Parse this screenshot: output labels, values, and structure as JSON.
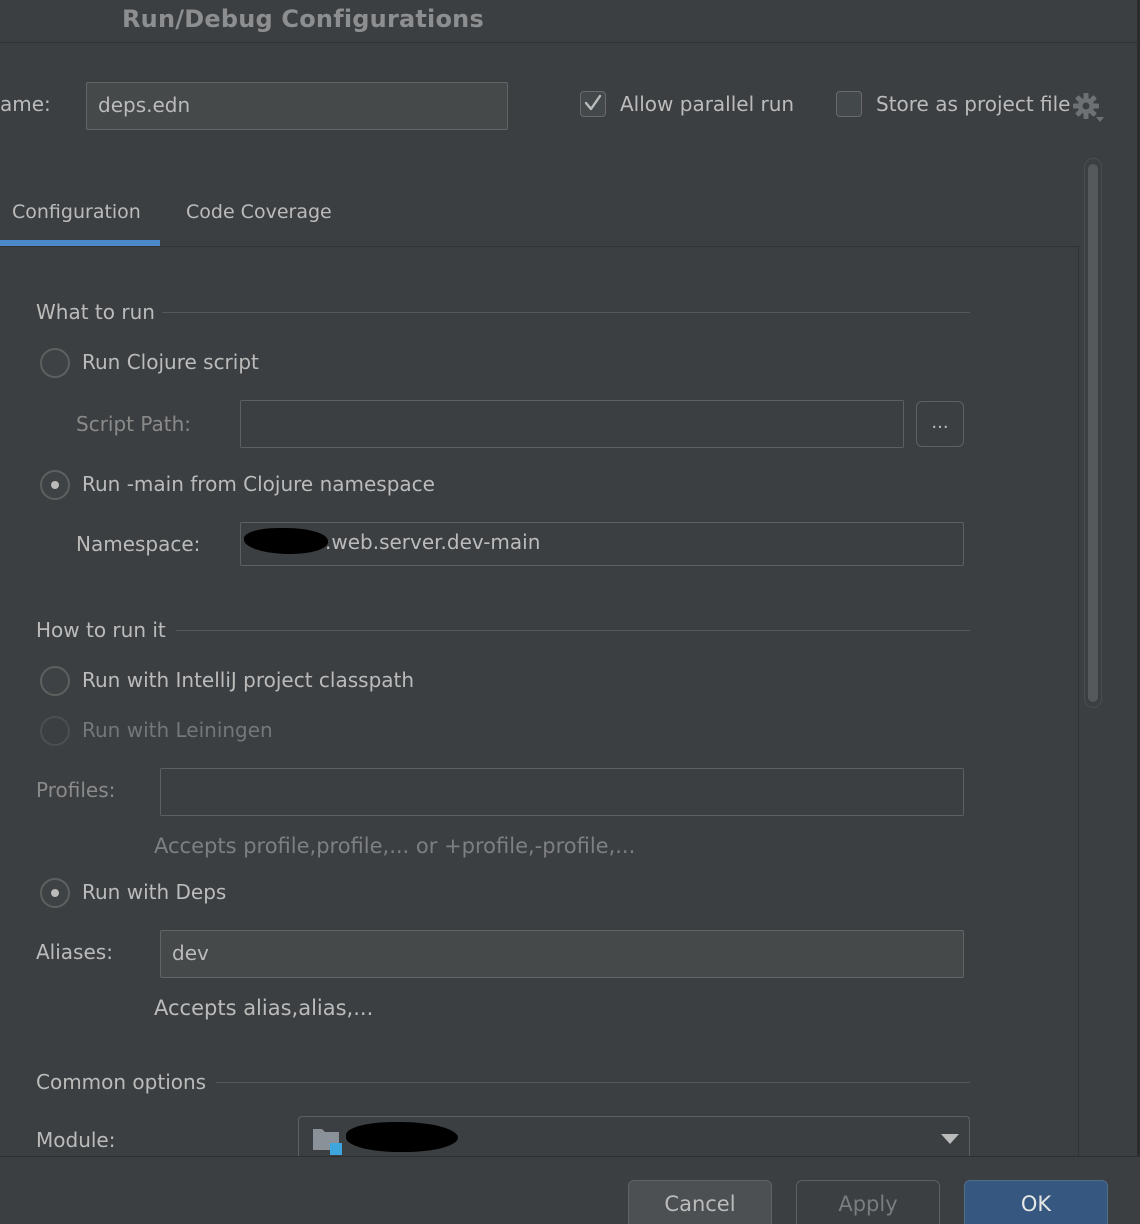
{
  "window": {
    "title": "Run/Debug Configurations"
  },
  "header": {
    "name_label": "ame:",
    "name_value": "deps.edn",
    "allow_parallel_run": {
      "label": "Allow parallel run",
      "checked": true
    },
    "store_as_project_file": {
      "label": "Store as project file",
      "checked": false
    }
  },
  "tabs": [
    {
      "label": "Configuration",
      "active": true
    },
    {
      "label": "Code Coverage",
      "active": false
    }
  ],
  "what_to_run": {
    "heading": "What to run",
    "run_clojure_script": {
      "label": "Run Clojure script",
      "checked": false
    },
    "script_path_label": "Script Path:",
    "script_path_value": "",
    "browse_label": "...",
    "run_main": {
      "label": "Run -main from Clojure namespace",
      "checked": true
    },
    "namespace_label": "Namespace:",
    "namespace_value": ".web.server.dev-main"
  },
  "how_to_run": {
    "heading": "How to run it",
    "intellij_classpath": {
      "label": "Run with IntelliJ project classpath",
      "checked": false
    },
    "leiningen": {
      "label": "Run with Leiningen",
      "checked": false,
      "disabled": true
    },
    "profiles_label": "Profiles:",
    "profiles_value": "",
    "profiles_hint": "Accepts profile,profile,... or +profile,-profile,...",
    "deps": {
      "label": "Run with Deps",
      "checked": true
    },
    "aliases_label": "Aliases:",
    "aliases_value": "dev",
    "aliases_hint": "Accepts alias,alias,..."
  },
  "common_options": {
    "heading": "Common options",
    "module_label": "Module:",
    "module_icon": "folder-module-icon"
  },
  "footer": {
    "cancel_label": "Cancel",
    "apply_label": "Apply",
    "ok_label": "OK"
  },
  "colors": {
    "background": "#3c3f41",
    "accent": "#4a88c7",
    "ok_button": "#365880",
    "module_icon_badge": "#3ea6dd"
  }
}
